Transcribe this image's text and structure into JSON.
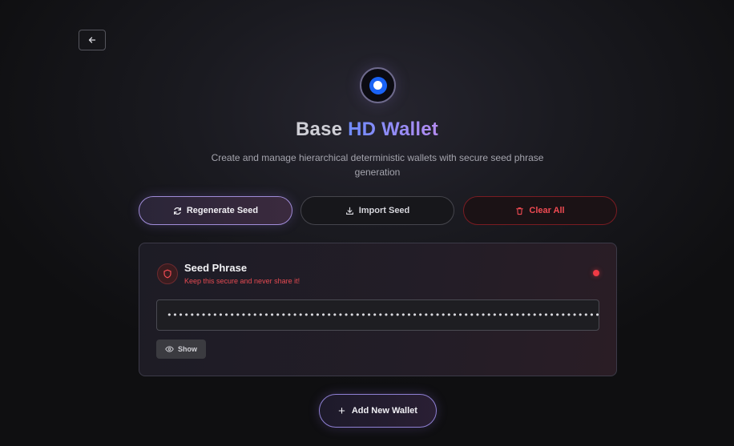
{
  "nav": {
    "back_icon": "arrow-left-icon"
  },
  "header": {
    "logo_icon": "base-logo-icon",
    "title_plain": "Base",
    "title_accent": "HD Wallet",
    "subtitle": "Create and manage hierarchical deterministic wallets with secure seed phrase generation"
  },
  "actions": {
    "regenerate": {
      "label": "Regenerate Seed",
      "icon": "refresh-icon"
    },
    "import": {
      "label": "Import Seed",
      "icon": "download-icon"
    },
    "clear": {
      "label": "Clear All",
      "icon": "trash-icon"
    }
  },
  "seed_card": {
    "icon": "shield-icon",
    "title": "Seed Phrase",
    "warning": "Keep this secure and never share it!",
    "masked_value": "••••••••••••••••••••••••••••••••••••••••••••••••••••••••••••••••••••••••••••••••",
    "show_label": "Show",
    "show_icon": "eye-icon",
    "status_color": "#ef3b45"
  },
  "add_wallet": {
    "label": "Add New Wallet",
    "icon": "plus-icon"
  },
  "colors": {
    "accent_start": "#6f8cff",
    "accent_end": "#b48cf0",
    "danger": "#ef4a52",
    "logo_blue": "#1a63f5"
  }
}
